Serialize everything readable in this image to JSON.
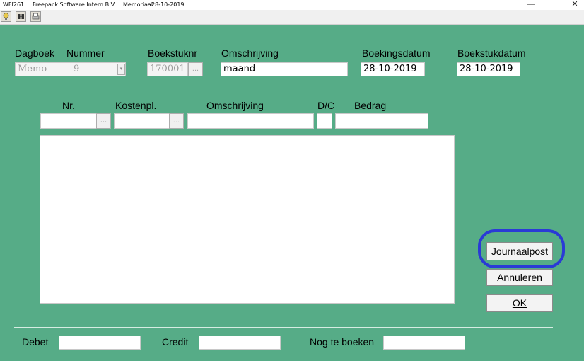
{
  "window": {
    "code": "WFI261",
    "company": "Freepack Software Intern B.V.",
    "module": "Memoriaal",
    "date": "28-10-2019",
    "minimize_glyph": "—",
    "maximize_glyph": "☐",
    "close_glyph": "✕"
  },
  "toolbar": {
    "icons": [
      "help-icon",
      "binoculars-icon",
      "printer-icon"
    ],
    "help_glyph": "?",
    "find_glyph": "👓",
    "print_glyph": "▤"
  },
  "header": {
    "dagboek_label": "Dagboek",
    "nummer_label": "Nummer",
    "boekstuknr_label": "Boekstuknr",
    "omschrijving_label": "Omschrijving",
    "boekingsdatum_label": "Boekingsdatum",
    "boekstukdatum_label": "Boekstukdatum",
    "dagboek_value": "Memo",
    "nummer_value": "9",
    "boekstuknr_value": "170001",
    "omschrijving_value": "maand",
    "boekingsdatum_value": "28-10-2019",
    "boekstukdatum_value": "28-10-2019",
    "ellipsis": "..."
  },
  "lines": {
    "nr_label": "Nr.",
    "kostenpl_label": "Kostenpl.",
    "omschrijving_label": "Omschrijving",
    "dc_label": "D/C",
    "bedrag_label": "Bedrag",
    "ellipsis": "..."
  },
  "buttons": {
    "journaalpost": "Journaalpost",
    "annuleren": "Annuleren",
    "ok": "OK"
  },
  "footer": {
    "debet_label": "Debet",
    "credit_label": "Credit",
    "nog_te_boeken_label": "Nog te boeken"
  },
  "colors": {
    "form_background": "#56ac87",
    "highlight": "#2a3ad6"
  }
}
